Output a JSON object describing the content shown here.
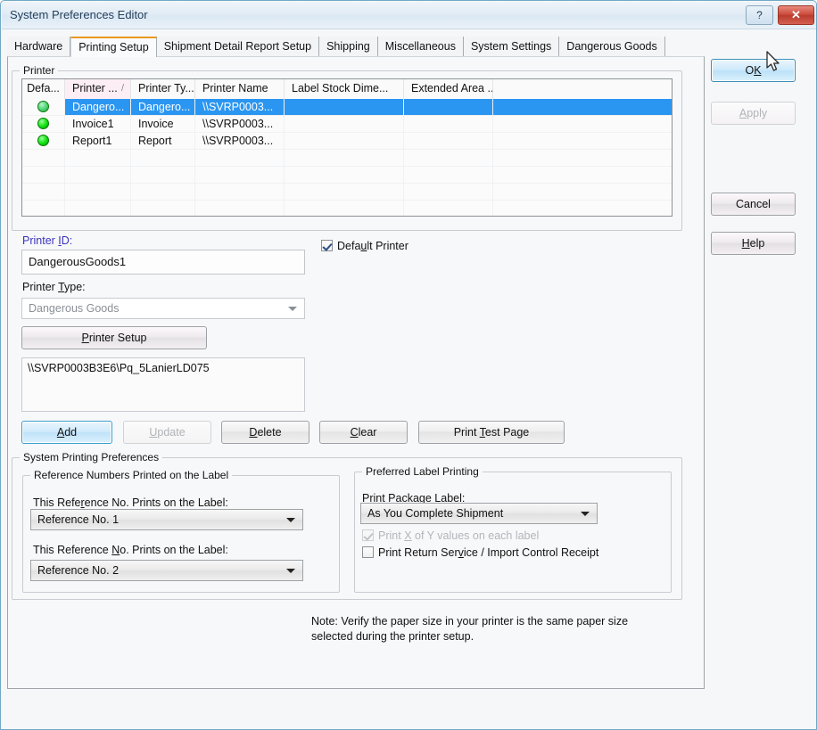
{
  "window": {
    "title": "System Preferences Editor",
    "help_button": "?",
    "close_button": "✕"
  },
  "tabs": [
    {
      "label": "Hardware",
      "active": false
    },
    {
      "label": "Printing Setup",
      "active": true
    },
    {
      "label": "Shipment Detail Report Setup",
      "active": false
    },
    {
      "label": "Shipping",
      "active": false
    },
    {
      "label": "Miscellaneous",
      "active": false
    },
    {
      "label": "System Settings",
      "active": false
    },
    {
      "label": "Dangerous Goods",
      "active": false
    }
  ],
  "printer_group": {
    "title": "Printer",
    "table": {
      "columns": [
        {
          "key": "default",
          "label": "Defa...",
          "sorted": false
        },
        {
          "key": "printer_id",
          "label": "Printer ...",
          "sorted": true,
          "sort_mark": "/"
        },
        {
          "key": "printer_type",
          "label": "Printer Ty...",
          "sorted": false
        },
        {
          "key": "printer_name",
          "label": "Printer Name",
          "sorted": false
        },
        {
          "key": "label_stock",
          "label": "Label Stock Dime...",
          "sorted": false
        },
        {
          "key": "extended_area",
          "label": "Extended Area ...",
          "sorted": false
        },
        {
          "key": "blank",
          "label": "",
          "sorted": false
        }
      ],
      "rows": [
        {
          "selected": true,
          "status": "green-bulb-icon",
          "printer_id": "Dangero...",
          "printer_type": "Dangero...",
          "printer_name": "\\\\SVRP0003...",
          "label_stock": "",
          "extended_area": "",
          "blank": ""
        },
        {
          "selected": false,
          "status": "green-bulb-icon",
          "printer_id": "Invoice1",
          "printer_type": "Invoice",
          "printer_name": "\\\\SVRP0003...",
          "label_stock": "",
          "extended_area": "",
          "blank": ""
        },
        {
          "selected": false,
          "status": "green-bulb-icon",
          "printer_id": "Report1",
          "printer_type": "Report",
          "printer_name": "\\\\SVRP0003...",
          "label_stock": "",
          "extended_area": "",
          "blank": ""
        }
      ],
      "empty_row_count": 4
    },
    "printer_id_label": "Printer ID:",
    "printer_id_value": "DangerousGoods1",
    "default_printer_label": "Default Printer",
    "default_printer_checked": true,
    "printer_type_label": "Printer Type:",
    "printer_type_value": "Dangerous Goods",
    "printer_setup_button": "Printer Setup",
    "printer_path_value": "\\\\SVRP0003B3E6\\Pq_5LanierLD075",
    "buttons": {
      "add": "Add",
      "update": "Update",
      "delete": "Delete",
      "clear": "Clear",
      "print_test_page": "Print Test Page"
    }
  },
  "system_printing_preferences": {
    "title": "System Printing Preferences",
    "reference_group": {
      "title": "Reference Numbers Printed on the Label",
      "ref1_label": "This Reference No. Prints on the Label:",
      "ref1_value": "Reference No. 1",
      "ref2_label": "This Reference No. Prints on the Label:",
      "ref2_value": "Reference No. 2"
    },
    "preferred_label_group": {
      "title": "Preferred Label Printing",
      "package_label_label": "Print Package Label:",
      "package_label_value": "As You Complete Shipment",
      "print_xy_label": "Print X of Y values on each label",
      "print_xy_checked": true,
      "print_xy_disabled": true,
      "print_return_label": "Print Return Service / Import Control Receipt",
      "print_return_checked": false
    }
  },
  "note": "Note: Verify the paper size in your printer is the same paper size selected during the printer setup.",
  "side_buttons": {
    "ok": "OK",
    "apply": "Apply",
    "cancel": "Cancel",
    "help": "Help"
  },
  "colors": {
    "selection_blue": "#2b96f1",
    "active_tab_underline": "#e8991f",
    "printer_id_label": "#3b34b8",
    "status_green": "#1ee81e",
    "close_red": "#c9483a"
  }
}
